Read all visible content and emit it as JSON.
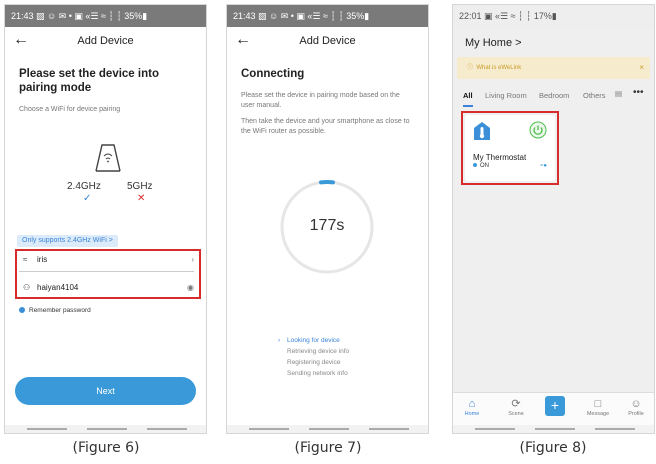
{
  "figure6": {
    "status": "21:43 ▨ ☺ ✉ •    ▣ «☰ ≈ ┆ ┆ 35%▮",
    "title": "Add Device",
    "heading": "Please set the device into pairing mode",
    "subtitle": "Choose a WiFi for device pairing",
    "freq_24": "2.4GHz",
    "freq_5": "5GHz",
    "pill": "Only supports 2.4GHz WiFi >",
    "wifi_name": "iris",
    "password": "haiyan4104",
    "remember": "Remember password",
    "next": "Next",
    "caption": "(Figure 6)"
  },
  "figure7": {
    "status": "21:43 ▨ ☺ ✉ •    ▣ «☰ ≈ ┆ ┆ 35%▮",
    "title": "Add Device",
    "heading": "Connecting",
    "text1": "Please set the device in pairing mode based on the user manual.",
    "text2": "Then take the device and your smartphone as close to the WiFi router as possible.",
    "countdown": "177s",
    "steps": [
      "Looking for device",
      "Retrieving device info",
      "Registering device",
      "Sending network info"
    ],
    "caption": "(Figure 7)"
  },
  "figure8": {
    "status": "22:01          ▣ «☰ ≈ ┆ ┆ 17%▮",
    "home": "My Home >",
    "banner": "What is eWeLink",
    "tabs": [
      "All",
      "Living Room",
      "Bedroom",
      "Others"
    ],
    "device_name": "My Thermostat",
    "device_state": "ON",
    "tabbar": [
      "Home",
      "Scene",
      "Message",
      "Profile"
    ],
    "caption": "(Figure 8)"
  },
  "colors": {
    "accent": "#3a9ad9",
    "highlight": "#d62c2c",
    "power": "#4cbf4c"
  }
}
